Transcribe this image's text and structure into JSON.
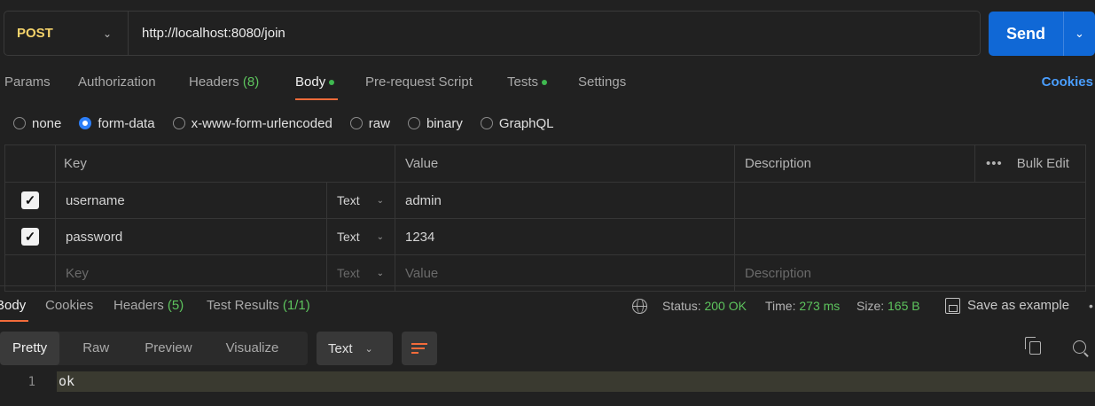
{
  "request": {
    "method": "POST",
    "url": "http://localhost:8080/join",
    "send_label": "Send"
  },
  "tabs": {
    "params": "Params",
    "authorization": "Authorization",
    "headers": "Headers",
    "headers_count": "(8)",
    "body": "Body",
    "prerequest": "Pre-request Script",
    "tests": "Tests",
    "settings": "Settings",
    "cookies": "Cookies"
  },
  "body_types": {
    "none": "none",
    "form_data": "form-data",
    "urlencoded": "x-www-form-urlencoded",
    "raw": "raw",
    "binary": "binary",
    "graphql": "GraphQL",
    "selected": "form-data"
  },
  "table": {
    "headers": {
      "key": "Key",
      "value": "Value",
      "description": "Description",
      "bulk_edit": "Bulk Edit"
    },
    "rows": [
      {
        "checked": true,
        "key": "username",
        "type": "Text",
        "value": "admin",
        "description": ""
      },
      {
        "checked": true,
        "key": "password",
        "type": "Text",
        "value": "1234",
        "description": ""
      }
    ],
    "placeholder": {
      "key": "Key",
      "type": "Text",
      "value": "Value",
      "description": "Description"
    }
  },
  "response": {
    "tabs": {
      "body": "Body",
      "cookies": "Cookies",
      "headers": "Headers",
      "headers_count": "(5)",
      "test_results": "Test Results",
      "test_results_count": "(1/1)"
    },
    "status_label": "Status:",
    "status": "200 OK",
    "time_label": "Time:",
    "time": "273 ms",
    "size_label": "Size:",
    "size": "165 B",
    "save_example": "Save as example",
    "views": {
      "pretty": "Pretty",
      "raw": "Raw",
      "preview": "Preview",
      "visualize": "Visualize"
    },
    "format": "Text",
    "lines": [
      {
        "number": "1",
        "text": "ok"
      }
    ]
  },
  "colors": {
    "accent": "#f26b3a",
    "send": "#1068d6",
    "success": "#5dc35d",
    "method": "#f5d36b",
    "link": "#4a9eff"
  }
}
